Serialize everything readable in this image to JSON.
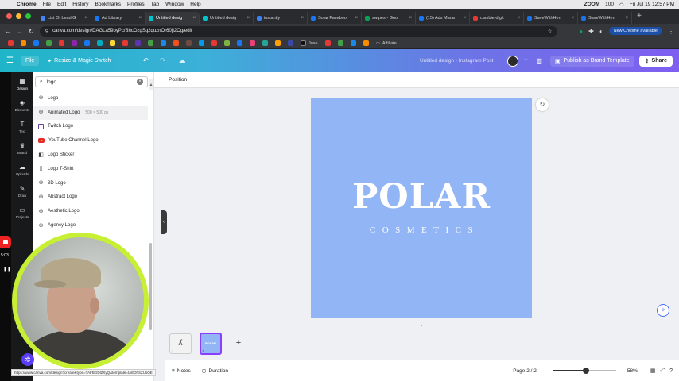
{
  "menubar": {
    "app": "Chrome",
    "items": [
      "File",
      "Edit",
      "History",
      "Bookmarks",
      "Profiles",
      "Tab",
      "Window",
      "Help"
    ],
    "zoom": "ZOOM",
    "battery": "100",
    "clock": "Fri Jul 19  12:57 PM"
  },
  "tabs": [
    {
      "label": "List Of Lead G",
      "color": "#4285f4"
    },
    {
      "label": "Ad Library",
      "color": "#1877f2"
    },
    {
      "label": "Untitled desig",
      "color": "#00c4cc",
      "active": true
    },
    {
      "label": "Untitled desig",
      "color": "#00c4cc"
    },
    {
      "label": "instantly",
      "color": "#3b82f6"
    },
    {
      "label": "Solar Faceboo",
      "color": "#1877f2"
    },
    {
      "label": "swipes - Goo",
      "color": "#0f9d58"
    },
    {
      "label": "(15) Ads Mana",
      "color": "#1877f2"
    },
    {
      "label": "cambie-digit",
      "color": "#e53935"
    },
    {
      "label": "SaveWithHen",
      "color": "#1a73e8"
    },
    {
      "label": "SaveWithHen",
      "color": "#1a73e8"
    }
  ],
  "address": {
    "url": "canva.com/design/DAGLa59byPc/BhcOzgSg2quznOr60jI2Og/edit",
    "chrome_available": "New Chrome available"
  },
  "bookmarks": {
    "affiliate_label": "Affiliate",
    "jose_label": "Jose"
  },
  "header": {
    "file": "File",
    "resize": "Resize & Magic Switch",
    "design_name": "Untitled design - Instagram Post",
    "brand_template": "Publish as Brand Template",
    "share": "Share"
  },
  "rail": [
    {
      "label": "Design",
      "icon": "design-icon",
      "glyph": "▦"
    },
    {
      "label": "Elements",
      "icon": "elements-icon",
      "glyph": "◈"
    },
    {
      "label": "Text",
      "icon": "text-icon",
      "glyph": "T"
    },
    {
      "label": "Brand",
      "icon": "brand-icon",
      "glyph": "♛"
    },
    {
      "label": "Uploads",
      "icon": "uploads-icon",
      "glyph": "☁"
    },
    {
      "label": "Draw",
      "icon": "draw-icon",
      "glyph": "✎"
    },
    {
      "label": "Projects",
      "icon": "projects-icon",
      "glyph": "▭"
    }
  ],
  "recording": {
    "time": "5:03"
  },
  "search": {
    "value": "logo",
    "placeholder": "Search"
  },
  "suggestions": [
    {
      "label": "Logo",
      "icon": "search-circle-icon",
      "glyph": "⊚"
    },
    {
      "label": "Animated Logo",
      "icon": "search-circle-icon",
      "glyph": "⊚",
      "extra": "500 × 500 px",
      "highlight": true
    },
    {
      "label": "Twitch Logo",
      "icon": "twitch-icon",
      "glyph": ""
    },
    {
      "label": "YouTube Channel Logo",
      "icon": "youtube-icon",
      "glyph": ""
    },
    {
      "label": "Logo Sticker",
      "icon": "sticker-icon",
      "glyph": "◧"
    },
    {
      "label": "Logo T-Shirt",
      "icon": "tshirt-icon",
      "glyph": "▯"
    },
    {
      "label": "3D Logo",
      "icon": "search-circle-icon",
      "glyph": "⊚"
    },
    {
      "label": "Abstract Logo",
      "icon": "search-circle-icon",
      "glyph": "⊚"
    },
    {
      "label": "Aesthetic Logo",
      "icon": "search-circle-icon",
      "glyph": "⊚"
    },
    {
      "label": "Agency Logo",
      "icon": "search-circle-icon",
      "glyph": "⊚"
    }
  ],
  "editor": {
    "toolbar_label": "Position",
    "canvas_bg": "#92b5f6",
    "title": "POLAR",
    "subtitle": "COSMETICS"
  },
  "pages": {
    "thumb2_text": "POLAR",
    "p1": "1",
    "p2": "2",
    "add": "+"
  },
  "bottombar": {
    "notes": "Notes",
    "duration": "Duration",
    "page": "Page 2 / 2",
    "zoom": "58%",
    "zoom_value": 58
  },
  "statusurl": "https://www.canva.com/design?create&type=TAFBGDlZXyQ&template=tAEDhSZUsQE"
}
